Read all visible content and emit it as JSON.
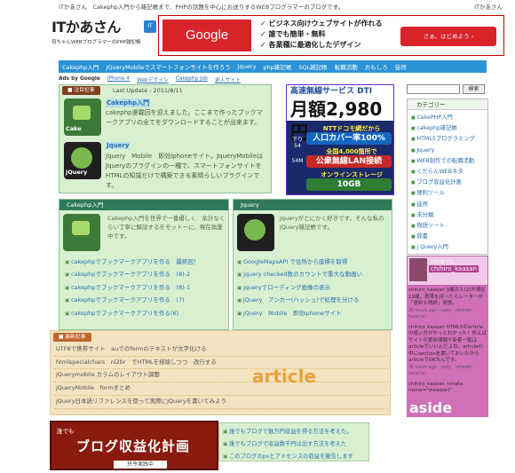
{
  "topbar": {
    "left": "ITかあさん　Cakephp入門から雑記帳まで、PHPの話題を中心にお送りするWEBプログラマーのブログです。",
    "right": "ITかあさん"
  },
  "logo": {
    "title": "ITかあさん",
    "subtitle": "母ちゃんWEBプログラマーのPHP雑記帳",
    "badge": "IT"
  },
  "ad": {
    "google": "Google",
    "lines": [
      "✓ ビジネス向けウェブサイトが作れる",
      "✓ 誰でも簡単・無料",
      "✓ 各業種に最適化したデザイン"
    ],
    "cta": "さぁ、はじめよう ›"
  },
  "nav": [
    "Cakephp入門",
    "JQueryMobileでスマートフォンサイトを作ろう",
    "Jquery",
    "php雑記帳",
    "SQL雑記帳",
    "転職活動",
    "おもしろ",
    "徒然"
  ],
  "adsbar": {
    "label": "Ads by Google",
    "links": [
      "iPhone 4",
      "Webデザイン",
      "Cakephp Job",
      "求人サイト"
    ]
  },
  "new_panel": {
    "tab": "■ 注目記事",
    "date": "Last Update : 2011/8/11",
    "entries": [
      {
        "thumb": "Cake",
        "title": "Cakephp入門",
        "body": "cakephp連載回を迎えました。ここまで作ったブックマークアプリの全てをダウンロードすることが出来ます。"
      },
      {
        "thumb": "jQuery",
        "title": "Jquery",
        "body": "Jquery　Mobile　即効iphoneサイト。JqueryMobileはJqueryのプラグインの一種で、スマートフォンサイトをHTMLの知識だけで構築できる素晴らしいプラグインです。"
      }
    ]
  },
  "dti_ad": {
    "header": "高速無線サービス DTI",
    "price": "月額2,980円",
    "r1": "NTTドコモ網だから",
    "b1": "人口カバー率100%",
    "r2": "全国4,000箇所で",
    "b2": "公衆無線LAN接続",
    "r3": "オンラインストレージ",
    "b3": "10GB",
    "side1": "下り54",
    "side2": "54M"
  },
  "search": {
    "button": "検索"
  },
  "category": {
    "header": "カテゴリー",
    "items": [
      "CakePHP入門",
      "cakephp雑記帳",
      "HTML5プログラミング",
      "Jquery",
      "WEB制作での転職活動",
      "くだらんWEBネタ",
      "ブログ収益化計画",
      "便利ツール",
      "徒然",
      "未分類",
      "物語ソート",
      "辞書",
      "j Query入門"
    ]
  },
  "aside": {
    "screen_name": "chihiro_kaasan",
    "small_name": "ITかあさん",
    "tweets": [
      {
        "text": "chihiro_kaasan 3歳次人(2)が現在19歳。携帯を持ったらレーターが「便利も残終」発表。",
        "meta": "36 hours ago · reply · retweet · favorite"
      },
      {
        "text": "chihiro_kaasan HTML5のarticleの使い方がやっとわかった！例えばサイトの更新情報や新着一覧はarticleでいいんだよね。articleの中にsectionを書いておいたからarticleでOKなんです。",
        "meta": "36 hours ago · reply · retweet · favorite"
      },
      {
        "text": "chihiro_kaasan <meta name=\"viewport\"",
        "meta": ""
      }
    ],
    "label": "aside"
  },
  "cake_box": {
    "header": "Cakephp入門",
    "body": "Cakephp入門を世界で一番優しく　余計なくらい丁寧に解説するをモットーに、現在執筆中です。",
    "links": [
      "cakephpでブックマークアプリを作る　最終回！",
      "cakephpでブックマークアプリを作る　(8)-2",
      "cakephpでブックマークアプリを作る　(8)-1",
      "cakephpでブックマークアプリを作る　(7)",
      "cakephpでブックマークアプリを作る(6)"
    ]
  },
  "jq_box": {
    "header": "Jquery",
    "body": "Jqueryがとにかく好きです。そんな私のjQuery雑記帳です。",
    "links": [
      "GoogleMapsAPI で住所から座標を取得",
      "Jquery checked数のカウントで重大な動画い",
      "Jqueryでローディング画像の表示",
      "jQuery　アンカー(ハッシュ)で処理を分ける",
      "jQuery　Mobile　即効iphoneサイト"
    ]
  },
  "article": {
    "tab": "■ 最新記事",
    "items": [
      "UTF8で携帯サイト　auでのformのテキストが文字化ける",
      "htmlspecialchars　nl2br　でHTMLを排除しつつ　改行する",
      "jQuerymobile カラムのレイアウト調整",
      "jQueryMobile　formまとめ",
      "jQuery日本語リファレンスを使って実際にjQueryを書いてみよう"
    ],
    "label": "article"
  },
  "banner": {
    "small": "誰でも",
    "big": "ブログ収益化計画",
    "foot": "只今実践中"
  },
  "bottom_links": [
    "誰でもブログで数万円収益を得る方法を考えた。",
    "誰でもブログで収益数千円は出す方法を考えた",
    "このブログのpvとアドセンスの収益を報告します"
  ]
}
